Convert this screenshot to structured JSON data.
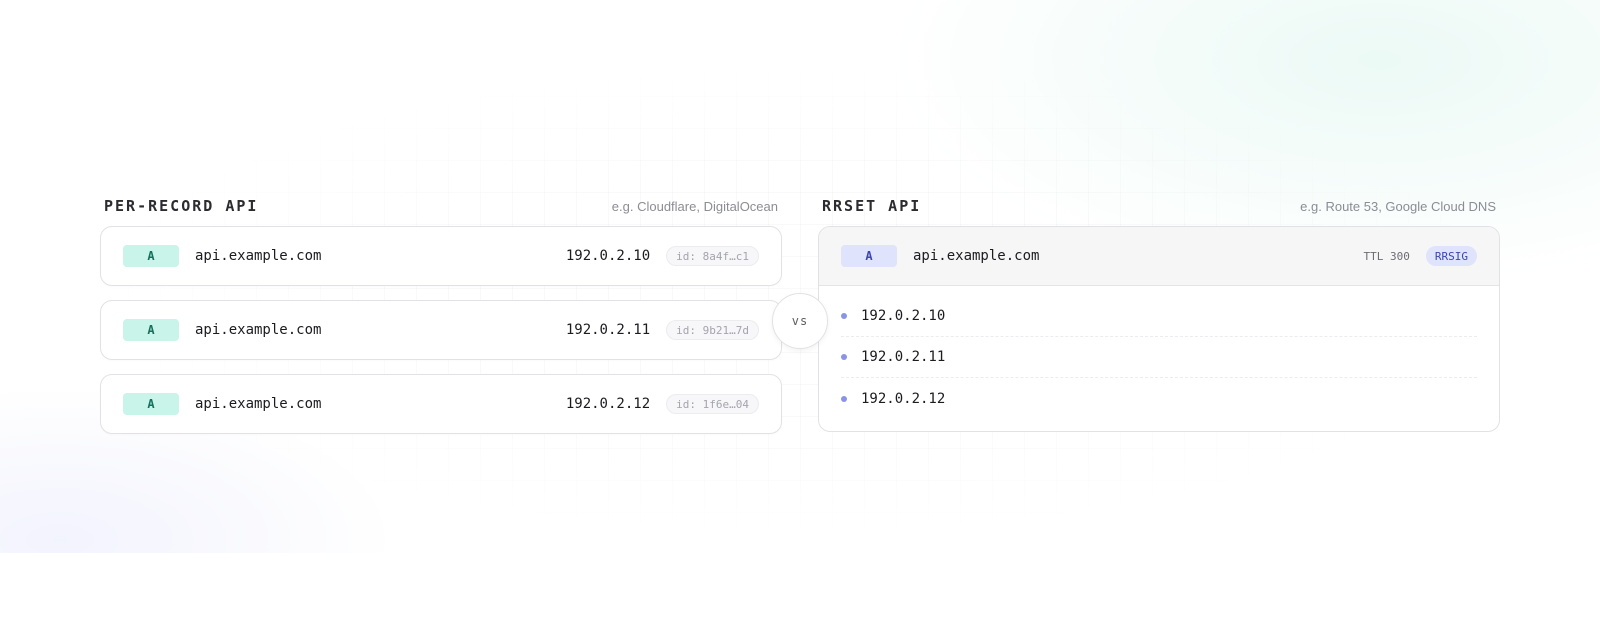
{
  "left_panel": {
    "title": "PER-RECORD API",
    "subtitle": "e.g. Cloudflare, DigitalOcean",
    "records": [
      {
        "type": "A",
        "name": "api.example.com",
        "ip": "192.0.2.10",
        "id": "id: 8a4f…c1"
      },
      {
        "type": "A",
        "name": "api.example.com",
        "ip": "192.0.2.11",
        "id": "id: 9b21…7d"
      },
      {
        "type": "A",
        "name": "api.example.com",
        "ip": "192.0.2.12",
        "id": "id: 1f6e…04"
      }
    ]
  },
  "divider": {
    "label": "vs"
  },
  "right_panel": {
    "title": "RRSET API",
    "subtitle": "e.g. Route 53, Google Cloud DNS",
    "rrset": {
      "type": "A",
      "name": "api.example.com",
      "ttl": "TTL 300",
      "signature": "RRSIG",
      "values": [
        "192.0.2.10",
        "192.0.2.11",
        "192.0.2.12"
      ]
    }
  },
  "colors": {
    "per_record_badge": "#c8f4ea",
    "rrset_badge": "#dfe3fb",
    "bullet": "#8b93e6"
  }
}
